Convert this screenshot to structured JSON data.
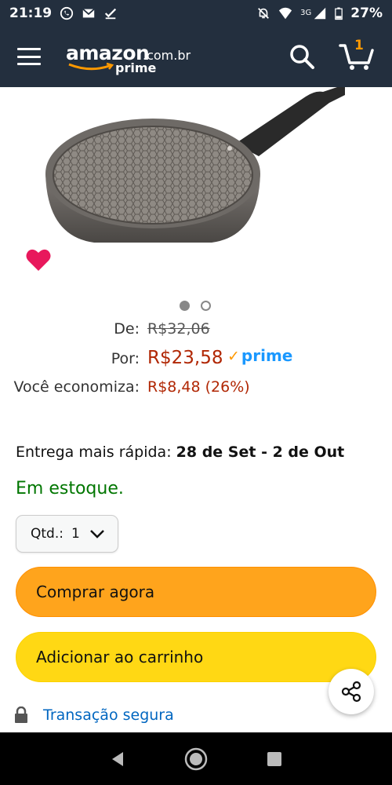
{
  "status_bar": {
    "time": "21:19",
    "network": "3G",
    "battery": "27%",
    "left_icons": [
      "whatsapp-icon",
      "gmail-icon",
      "download-done-icon"
    ],
    "right_icons": [
      "muted-bell-icon",
      "wifi-icon",
      "signal-icon",
      "battery-icon"
    ]
  },
  "header": {
    "logo_brand": "amazon",
    "logo_domain": ".com.br",
    "logo_prime": "prime",
    "cart_count": "1",
    "colors": {
      "background": "#232f3e",
      "accent": "#ff9900"
    }
  },
  "product": {
    "image_alt": "frying-pan",
    "carousel": {
      "current": 1,
      "total": 2
    }
  },
  "pricing": {
    "de_label": "De:",
    "old_price": "R$32,06",
    "por_label": "Por:",
    "new_price": "R$23,58",
    "prime_label": "prime",
    "savings_label": "Você economiza:",
    "savings_value": "R$8,48 (26%)"
  },
  "delivery": {
    "label": "Entrega mais rápida:",
    "dates": "28 de Set - 2 de Out"
  },
  "stock": "Em estoque.",
  "quantity": {
    "label": "Qtd.:",
    "value": "1"
  },
  "buttons": {
    "buy_now": "Comprar agora",
    "add_to_cart": "Adicionar ao carrinho"
  },
  "secure": "Transação segura"
}
